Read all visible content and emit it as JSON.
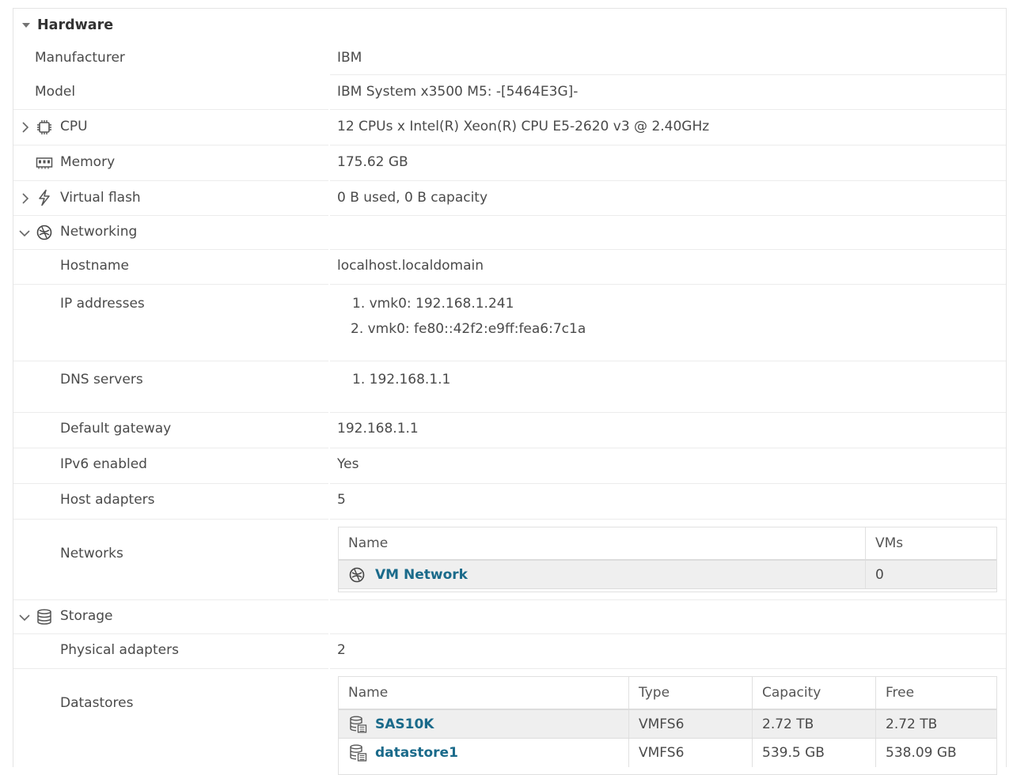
{
  "section_title": "Hardware",
  "rows": {
    "manufacturer": {
      "label": "Manufacturer",
      "value": "IBM"
    },
    "model": {
      "label": "Model",
      "value": "IBM System x3500 M5: -[5464E3G]-"
    },
    "cpu": {
      "label": "CPU",
      "value": "12 CPUs x Intel(R) Xeon(R) CPU E5-2620 v3 @ 2.40GHz"
    },
    "memory": {
      "label": "Memory",
      "value": "175.62 GB"
    },
    "virtual_flash": {
      "label": "Virtual flash",
      "value": "0 B used, 0 B capacity"
    },
    "networking": {
      "label": "Networking"
    },
    "hostname": {
      "label": "Hostname",
      "value": "localhost.localdomain"
    },
    "ip_addresses": {
      "label": "IP addresses",
      "items": [
        "1. vmk0: 192.168.1.241",
        "2. vmk0: fe80::42f2:e9ff:fea6:7c1a"
      ]
    },
    "dns_servers": {
      "label": "DNS servers",
      "items": [
        "1. 192.168.1.1"
      ]
    },
    "default_gateway": {
      "label": "Default gateway",
      "value": "192.168.1.1"
    },
    "ipv6_enabled": {
      "label": "IPv6 enabled",
      "value": "Yes"
    },
    "host_adapters": {
      "label": "Host adapters",
      "value": "5"
    },
    "networks": {
      "label": "Networks",
      "columns": [
        "Name",
        "VMs"
      ],
      "rows": [
        {
          "name": "VM Network",
          "vms": "0"
        }
      ]
    },
    "storage": {
      "label": "Storage"
    },
    "physical_adapters": {
      "label": "Physical adapters",
      "value": "2"
    },
    "datastores": {
      "label": "Datastores",
      "columns": [
        "Name",
        "Type",
        "Capacity",
        "Free"
      ],
      "rows": [
        {
          "name": "SAS10K",
          "type": "VMFS6",
          "capacity": "2.72 TB",
          "free": "2.72 TB"
        },
        {
          "name": "datastore1",
          "type": "VMFS6",
          "capacity": "539.5 GB",
          "free": "538.09 GB"
        }
      ]
    }
  },
  "icons": {
    "cpu": "chip-icon",
    "memory": "memory-icon",
    "virtual_flash": "flash-icon",
    "networking": "network-icon",
    "storage": "storage-icon",
    "datastore": "datastore-icon"
  },
  "colors": {
    "link": "#1a6a8a",
    "grid_row_bg": "#efefef",
    "border": "#ececec"
  }
}
